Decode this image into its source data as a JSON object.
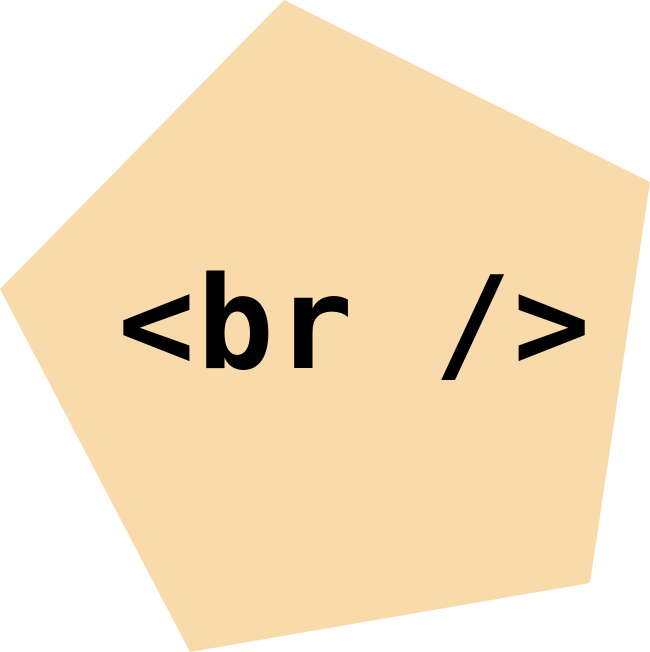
{
  "graphic": {
    "shape": "pentagon",
    "fill_color": "#F9DAAA",
    "text_color": "#000000",
    "label": "<br />"
  }
}
